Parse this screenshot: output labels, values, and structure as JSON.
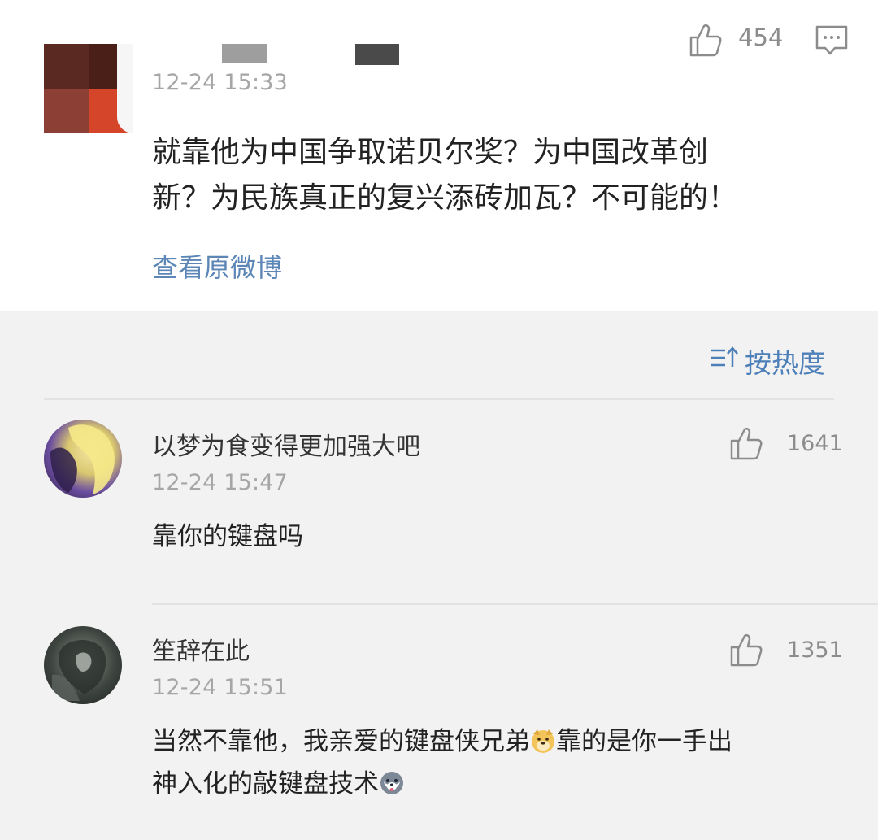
{
  "post": {
    "timestamp": "12-24 15:33",
    "like_count": "454",
    "text_line1": "就靠他为中国争取诺贝尔奖？为中国改革创",
    "text_line2": "新？为民族真正的复兴添砖加瓦？不可能的！",
    "view_original": "查看原微博"
  },
  "sort": {
    "label": "按热度"
  },
  "comments": [
    {
      "name": "以梦为食变得更加强大吧",
      "timestamp": "12-24 15:47",
      "like_count": "1641",
      "text_line1": "靠你的键盘吗"
    },
    {
      "name": "笙辞在此",
      "timestamp": "12-24 15:51",
      "like_count": "1351",
      "text_line1_a": "当然不靠他，我亲爱的键盘侠兄弟",
      "text_line1_b": "靠的是你一手出",
      "text_line2": "神入化的敲键盘技术"
    }
  ],
  "icons": {
    "like": "thumbs-up-icon",
    "comment": "comment-icon",
    "sort": "sort-icon",
    "emoji_dog": "doge-emoji-icon",
    "emoji_husky": "husky-emoji-icon"
  },
  "colors": {
    "link": "#5b86b6",
    "sort": "#4d7fb8",
    "timestamp": "#a6a6a6",
    "background": "#f2f2f2"
  }
}
